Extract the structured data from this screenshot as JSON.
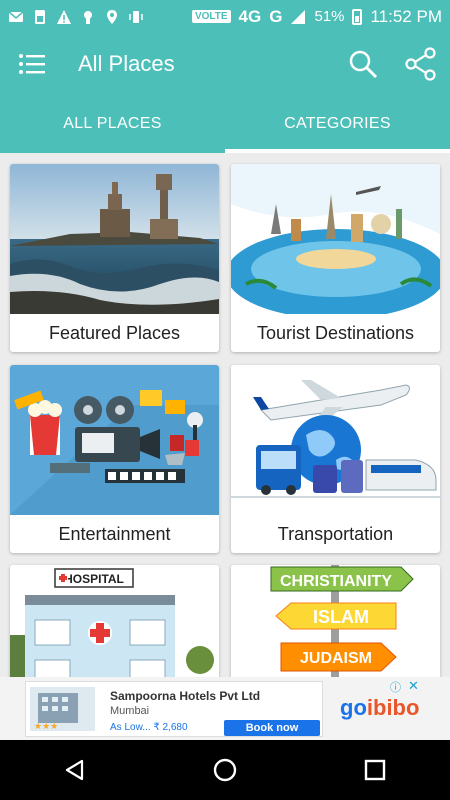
{
  "status_bar": {
    "network": "VOLTE",
    "network_type_1": "4G",
    "network_type_2": "G",
    "battery_percent": "51%",
    "time": "11:52 PM"
  },
  "app_bar": {
    "title": "All Places",
    "icons": [
      "menu-icon",
      "search-icon",
      "share-icon"
    ]
  },
  "tabs": [
    {
      "label": "ALL PLACES",
      "active": false
    },
    {
      "label": "CATEGORIES",
      "active": true
    }
  ],
  "categories": [
    {
      "label": "Featured Places"
    },
    {
      "label": "Tourist Destinations"
    },
    {
      "label": "Entertainment"
    },
    {
      "label": "Transportation"
    },
    {
      "label": "HOSPITAL"
    },
    {
      "label": "CHRISTIANITY",
      "sub": [
        "ISLAM",
        "JUDAISM"
      ]
    }
  ],
  "ad": {
    "name": "Sampoorna Hotels Pvt Ltd",
    "city": "Mumbai",
    "price": "As Low... ₹ 2,680",
    "cta": "Book now",
    "brand_go": "go",
    "brand_ibibo": "ibibo"
  },
  "colors": {
    "primary": "#4cbfb8",
    "indicator": "#ffffff"
  }
}
